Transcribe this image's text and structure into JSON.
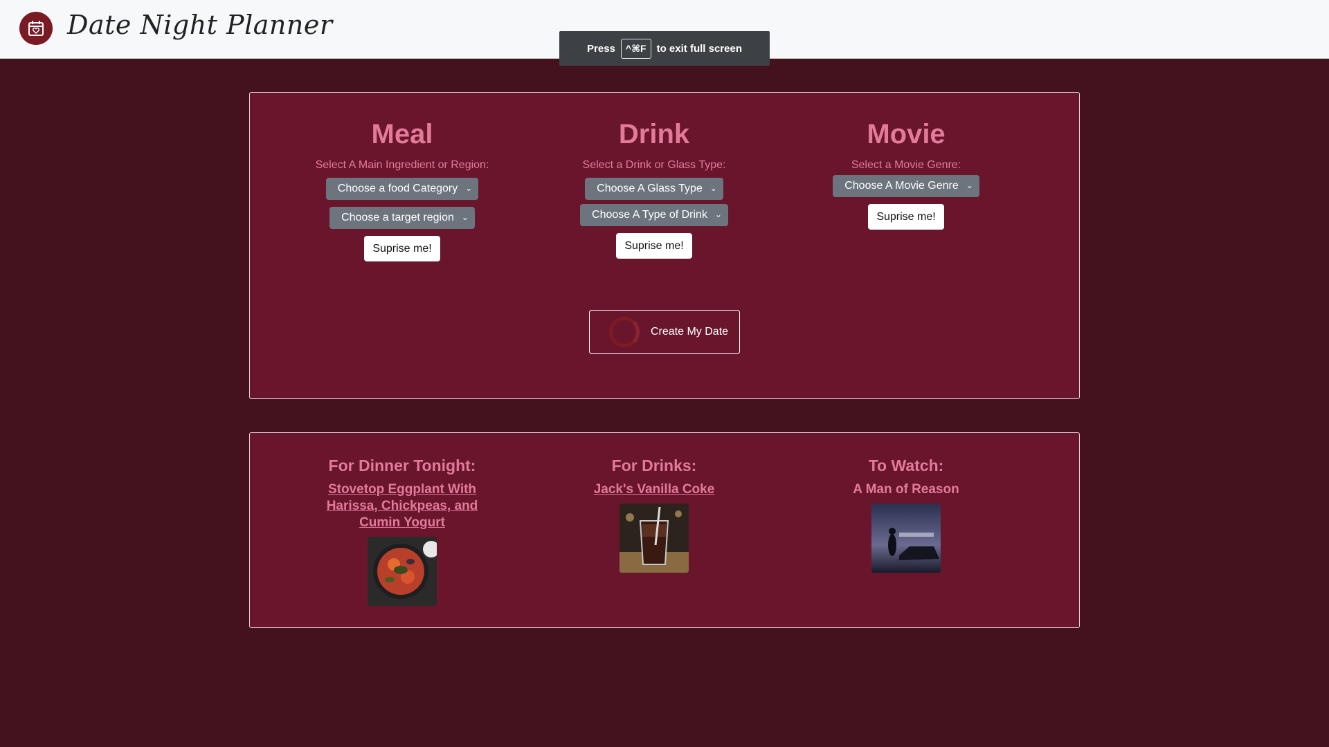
{
  "header": {
    "brand": "Date Night Planner",
    "logo_icon": "calendar-heart-icon"
  },
  "fullscreen_notice": {
    "prefix": "Press",
    "key": "^⌘F",
    "suffix": "to exit full screen"
  },
  "meal": {
    "heading": "Meal",
    "caption": "Select A Main Ingredient or Region:",
    "category_select": "Choose a food Category",
    "region_select": "Choose a target region",
    "surprise": "Suprise me!"
  },
  "drink": {
    "heading": "Drink",
    "caption": "Select a Drink or Glass Type:",
    "glass_select": "Choose A Glass Type",
    "type_select": "Choose A Type of Drink",
    "surprise": "Suprise me!"
  },
  "movie": {
    "heading": "Movie",
    "caption": "Select a Movie Genre:",
    "genre_select": "Choose A Movie Genre",
    "surprise": "Suprise me!"
  },
  "create_button": "Create My Date",
  "results": {
    "dinner": {
      "heading": "For Dinner Tonight:",
      "title": "Stovetop Eggplant With Harissa, Chickpeas, and Cumin Yogurt"
    },
    "drinks": {
      "heading": "For Drinks:",
      "title": "Jack's Vanilla Coke"
    },
    "watch": {
      "heading": "To Watch:",
      "title": "A Man of Reason"
    }
  },
  "colors": {
    "page_bg": "#44111f",
    "panel_bg": "#69162d",
    "accent_pink": "#e27a98",
    "select_gray": "#6c757d",
    "logo_red": "#7a1a24"
  }
}
